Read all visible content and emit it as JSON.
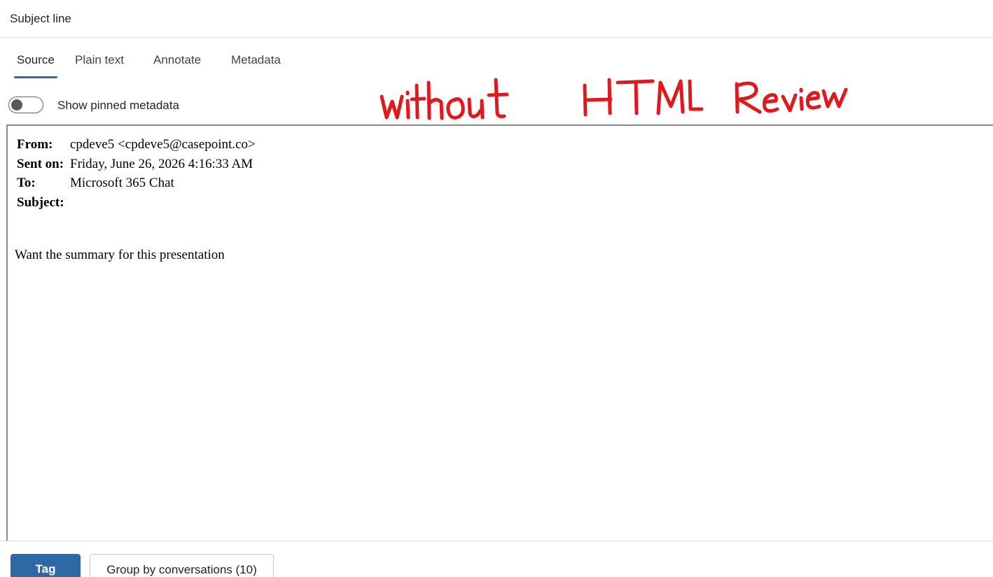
{
  "header": {
    "title": "Subject line"
  },
  "tabs": [
    {
      "label": "Source",
      "active": true
    },
    {
      "label": "Plain text",
      "active": false
    },
    {
      "label": "Annotate",
      "active": false
    },
    {
      "label": "Metadata",
      "active": false
    }
  ],
  "toggle": {
    "label": "Show pinned metadata",
    "on": false
  },
  "annotation": {
    "text": "without HTML Review",
    "color": "#e0191f"
  },
  "email": {
    "fields": [
      {
        "key": "From:",
        "value": "cpdeve5 <cpdeve5@casepoint.co>"
      },
      {
        "key": "Sent on:",
        "value": "Friday, June 26, 2026 4:16:33 AM"
      },
      {
        "key": "To:",
        "value": "Microsoft 365 Chat"
      },
      {
        "key": "Subject:",
        "value": ""
      }
    ],
    "body": "Want the summary for this presentation"
  },
  "footer": {
    "tag_label": "Tag",
    "group_label": "Group by conversations (10)"
  },
  "colors": {
    "accent": "#2d6aa5"
  }
}
